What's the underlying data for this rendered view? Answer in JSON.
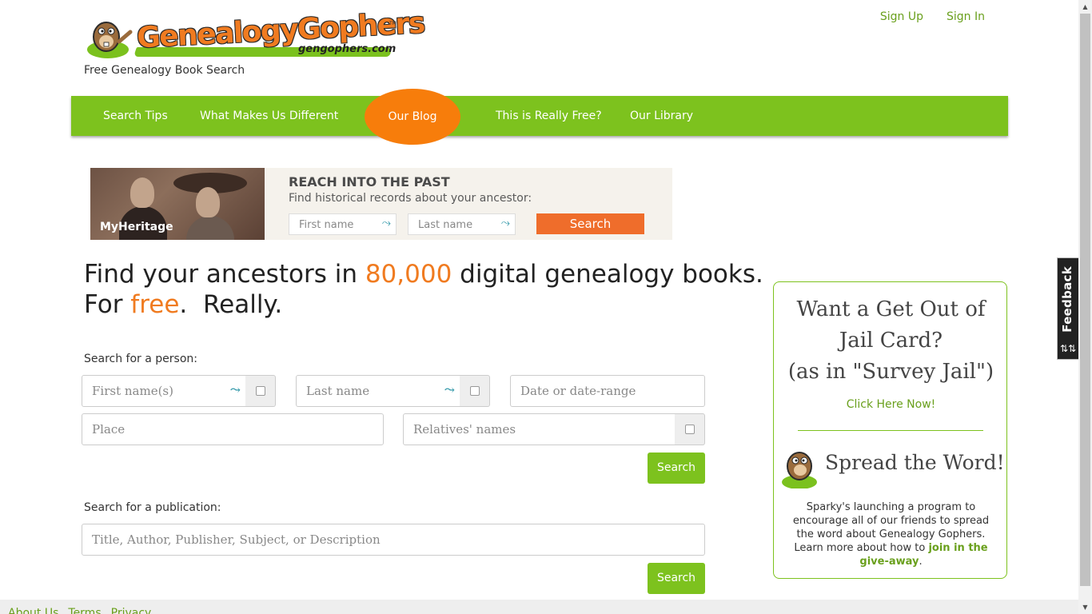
{
  "header": {
    "brand": "GenealogyGophers",
    "domain": "gengophers.com",
    "trademark": "TM",
    "tagline": "Free Genealogy Book Search",
    "links": [
      "Sign Up",
      "Sign In"
    ]
  },
  "nav": {
    "items": [
      "Search Tips",
      "What Makes Us Different",
      "Our Blog",
      "This is Really Free?",
      "Our Library"
    ],
    "highlight_color": "#f77d0b",
    "bar_color": "#7dc21e"
  },
  "ad": {
    "logo_text": "MyHeritage",
    "heading": "REACH INTO THE PAST",
    "subheading": "Find historical records about your ancestor:",
    "first_name_placeholder": "First name",
    "last_name_placeholder": "Last name",
    "button": "Search",
    "button_color": "#ef6d2b"
  },
  "hero": {
    "line1_pre": "Find your ancestors in ",
    "line1_num": "80,000",
    "line1_post": " digital genealogy books.",
    "line2_pre": "For ",
    "line2_free": "free",
    "line2_post": ".  Really."
  },
  "person_search": {
    "label": "Search for a person:",
    "first_name": "First name(s)",
    "last_name": "Last name",
    "date": "Date or date-range",
    "place": "Place",
    "relatives": "Relatives' names",
    "button": "Search"
  },
  "publication_search": {
    "label": "Search for a publication:",
    "placeholder": "Title, Author, Publisher, Subject, or Description",
    "button": "Search"
  },
  "sidebar": {
    "jail_line1": "Want a Get Out of",
    "jail_line2": "Jail Card?",
    "jail_line3": "(as in \"Survey Jail\")",
    "click": "Click Here Now!",
    "spread": "Spread the Word!",
    "desc_pre": "Sparky's launching a program to encourage all of our friends to spread the word about Genealogy Gophers. Learn more about how to ",
    "desc_link": "join in the give-away",
    "desc_post": "."
  },
  "feedback": {
    "label": "Feedback",
    "icon": "sort-icon"
  },
  "footer": {
    "links": [
      "About Us",
      "Terms",
      "Privacy"
    ]
  }
}
